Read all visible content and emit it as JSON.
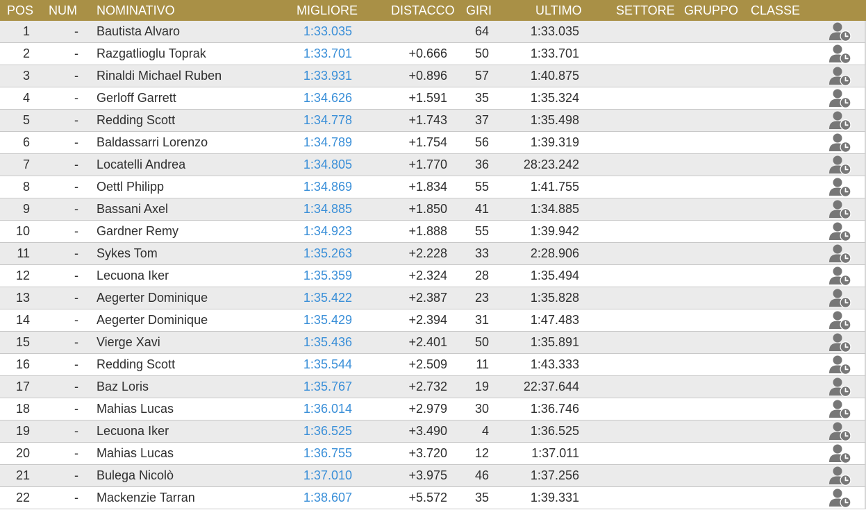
{
  "columns": {
    "pos": "POS",
    "num": "NUM",
    "name": "NOMINATIVO",
    "best": "MIGLIORE",
    "gap": "DISTACCO",
    "laps": "GIRI",
    "last": "ULTIMO",
    "sector": "SETTORE",
    "group": "GRUPPO",
    "class": "CLASSE"
  },
  "colors": {
    "header_bg": "#a99046",
    "header_text": "#ffffff",
    "best_lap_text": "#3a8fd8",
    "row_alt_bg": "#ebebeb",
    "icon": "#777777"
  },
  "row_icon": "user-clock-icon",
  "rows": [
    {
      "pos": "1",
      "num": "-",
      "name": "Bautista Alvaro",
      "best": "1:33.035",
      "gap": "",
      "laps": "64",
      "last": "1:33.035"
    },
    {
      "pos": "2",
      "num": "-",
      "name": "Razgatlioglu Toprak",
      "best": "1:33.701",
      "gap": "+0.666",
      "laps": "50",
      "last": "1:33.701"
    },
    {
      "pos": "3",
      "num": "-",
      "name": "Rinaldi Michael Ruben",
      "best": "1:33.931",
      "gap": "+0.896",
      "laps": "57",
      "last": "1:40.875"
    },
    {
      "pos": "4",
      "num": "-",
      "name": "Gerloff Garrett",
      "best": "1:34.626",
      "gap": "+1.591",
      "laps": "35",
      "last": "1:35.324"
    },
    {
      "pos": "5",
      "num": "-",
      "name": "Redding Scott",
      "best": "1:34.778",
      "gap": "+1.743",
      "laps": "37",
      "last": "1:35.498"
    },
    {
      "pos": "6",
      "num": "-",
      "name": "Baldassarri Lorenzo",
      "best": "1:34.789",
      "gap": "+1.754",
      "laps": "56",
      "last": "1:39.319"
    },
    {
      "pos": "7",
      "num": "-",
      "name": "Locatelli Andrea",
      "best": "1:34.805",
      "gap": "+1.770",
      "laps": "36",
      "last": "28:23.242"
    },
    {
      "pos": "8",
      "num": "-",
      "name": "Oettl Philipp",
      "best": "1:34.869",
      "gap": "+1.834",
      "laps": "55",
      "last": "1:41.755"
    },
    {
      "pos": "9",
      "num": "-",
      "name": "Bassani Axel",
      "best": "1:34.885",
      "gap": "+1.850",
      "laps": "41",
      "last": "1:34.885"
    },
    {
      "pos": "10",
      "num": "-",
      "name": "Gardner Remy",
      "best": "1:34.923",
      "gap": "+1.888",
      "laps": "55",
      "last": "1:39.942"
    },
    {
      "pos": "11",
      "num": "-",
      "name": "Sykes Tom",
      "best": "1:35.263",
      "gap": "+2.228",
      "laps": "33",
      "last": "2:28.906"
    },
    {
      "pos": "12",
      "num": "-",
      "name": "Lecuona Iker",
      "best": "1:35.359",
      "gap": "+2.324",
      "laps": "28",
      "last": "1:35.494"
    },
    {
      "pos": "13",
      "num": "-",
      "name": "Aegerter Dominique",
      "best": "1:35.422",
      "gap": "+2.387",
      "laps": "23",
      "last": "1:35.828"
    },
    {
      "pos": "14",
      "num": "-",
      "name": "Aegerter Dominique",
      "best": "1:35.429",
      "gap": "+2.394",
      "laps": "31",
      "last": "1:47.483"
    },
    {
      "pos": "15",
      "num": "-",
      "name": "Vierge Xavi",
      "best": "1:35.436",
      "gap": "+2.401",
      "laps": "50",
      "last": "1:35.891"
    },
    {
      "pos": "16",
      "num": "-",
      "name": "Redding Scott",
      "best": "1:35.544",
      "gap": "+2.509",
      "laps": "11",
      "last": "1:43.333"
    },
    {
      "pos": "17",
      "num": "-",
      "name": "Baz Loris",
      "best": "1:35.767",
      "gap": "+2.732",
      "laps": "19",
      "last": "22:37.644"
    },
    {
      "pos": "18",
      "num": "-",
      "name": "Mahias Lucas",
      "best": "1:36.014",
      "gap": "+2.979",
      "laps": "30",
      "last": "1:36.746"
    },
    {
      "pos": "19",
      "num": "-",
      "name": "Lecuona Iker",
      "best": "1:36.525",
      "gap": "+3.490",
      "laps": "4",
      "last": "1:36.525"
    },
    {
      "pos": "20",
      "num": "-",
      "name": "Mahias Lucas",
      "best": "1:36.755",
      "gap": "+3.720",
      "laps": "12",
      "last": "1:37.011"
    },
    {
      "pos": "21",
      "num": "-",
      "name": "Bulega Nicolò",
      "best": "1:37.010",
      "gap": "+3.975",
      "laps": "46",
      "last": "1:37.256"
    },
    {
      "pos": "22",
      "num": "-",
      "name": "Mackenzie Tarran",
      "best": "1:38.607",
      "gap": "+5.572",
      "laps": "35",
      "last": "1:39.331"
    }
  ]
}
